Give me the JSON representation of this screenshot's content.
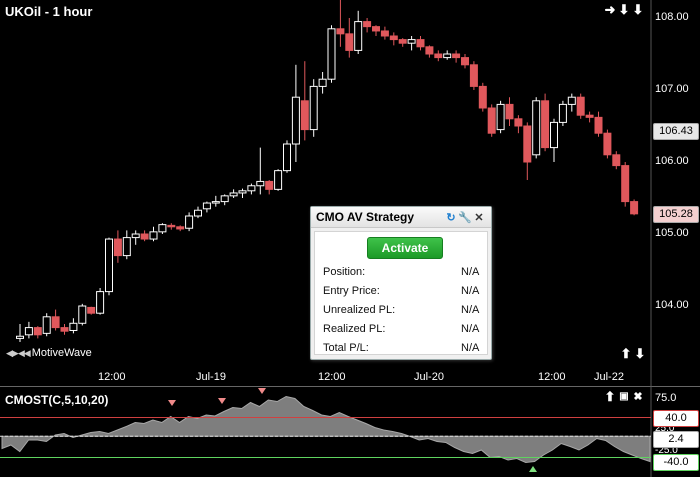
{
  "window": {
    "title": "UKOil - 1 hour",
    "brand": "MotiveWave"
  },
  "price_axis": {
    "labels": [
      "108.00",
      "107.00",
      "106.00",
      "105.00",
      "104.00"
    ],
    "tag_current": "106.43",
    "tag_last": "105.28"
  },
  "time_axis": {
    "labels": [
      "12:00",
      "Jul-19",
      "12:00",
      "Jul-20",
      "12:00",
      "Jul-22"
    ]
  },
  "indicator": {
    "title": "CMOST(C,5,10,20)",
    "axis_labels": [
      "75.0",
      "25.0",
      "-25.0"
    ],
    "tag_upper": "40.0",
    "tag_mid": "2.4",
    "tag_lower": "-40.0"
  },
  "strategy_panel": {
    "title": "CMO AV Strategy",
    "activate_label": "Activate",
    "rows": [
      {
        "label": "Position:",
        "value": "N/A"
      },
      {
        "label": "Entry Price:",
        "value": "N/A"
      },
      {
        "label": "Unrealized PL:",
        "value": "N/A"
      },
      {
        "label": "Realized PL:",
        "value": "N/A"
      },
      {
        "label": "Total P/L:",
        "value": "N/A"
      }
    ]
  },
  "icons": {
    "nav_right": "arrow-right-icon",
    "nav_down": "arrow-down-icon",
    "nav_zoom_down": "arrow-down-icon",
    "panel_refresh": "refresh-icon",
    "panel_settings": "wrench-icon",
    "panel_close": "close-icon"
  },
  "colors": {
    "background": "#000000",
    "up_candle": "#ffffff",
    "down_candle": "#e0585c",
    "upper_line": "#d04040",
    "lower_line": "#5fd35f",
    "osc_fill": "#8c8c8c",
    "activate": "#22a32e"
  },
  "chart_data": [
    {
      "type": "candlestick",
      "title": "UKOil - 1 hour",
      "yticks": [
        108.0,
        107.0,
        106.0,
        105.0,
        104.0
      ],
      "ylim": [
        103.3,
        108.4
      ],
      "series": [
        {
          "values": [
            [
              103.55,
              103.75,
              103.5,
              103.58
            ],
            [
              103.6,
              103.78,
              103.55,
              103.7
            ],
            [
              103.7,
              103.72,
              103.55,
              103.6
            ],
            [
              103.62,
              103.9,
              103.58,
              103.85
            ],
            [
              103.85,
              103.95,
              103.66,
              103.7
            ],
            [
              103.7,
              103.75,
              103.6,
              103.65
            ],
            [
              103.66,
              103.83,
              103.62,
              103.76
            ],
            [
              103.76,
              104.03,
              103.73,
              104.0
            ],
            [
              103.98,
              103.99,
              103.88,
              103.9
            ],
            [
              103.9,
              104.25,
              103.88,
              104.2
            ],
            [
              104.2,
              104.95,
              104.15,
              104.93
            ],
            [
              104.93,
              105.05,
              104.6,
              104.7
            ],
            [
              104.7,
              105.05,
              104.65,
              104.95
            ],
            [
              104.95,
              105.05,
              104.85,
              105.0
            ],
            [
              105.0,
              105.05,
              104.9,
              104.93
            ],
            [
              104.93,
              105.1,
              104.9,
              105.03
            ],
            [
              105.03,
              105.15,
              105.0,
              105.13
            ],
            [
              105.12,
              105.15,
              105.06,
              105.1
            ],
            [
              105.1,
              105.12,
              105.04,
              105.07
            ],
            [
              105.08,
              105.3,
              105.04,
              105.25
            ],
            [
              105.25,
              105.38,
              105.22,
              105.33
            ],
            [
              105.35,
              105.45,
              105.3,
              105.43
            ],
            [
              105.43,
              105.53,
              105.38,
              105.45
            ],
            [
              105.45,
              105.55,
              105.4,
              105.53
            ],
            [
              105.53,
              105.62,
              105.5,
              105.57
            ],
            [
              105.57,
              105.63,
              105.5,
              105.6
            ],
            [
              105.6,
              105.7,
              105.55,
              105.67
            ],
            [
              105.67,
              106.2,
              105.55,
              105.73
            ],
            [
              105.73,
              105.75,
              105.55,
              105.62
            ],
            [
              105.62,
              105.9,
              105.6,
              105.88
            ],
            [
              105.88,
              106.3,
              105.85,
              106.25
            ],
            [
              106.25,
              107.35,
              106.0,
              106.9
            ],
            [
              106.85,
              107.4,
              106.3,
              106.45
            ],
            [
              106.45,
              107.15,
              106.35,
              107.05
            ],
            [
              107.05,
              107.25,
              106.95,
              107.15
            ],
            [
              107.15,
              107.9,
              107.1,
              107.85
            ],
            [
              107.85,
              108.25,
              107.6,
              107.78
            ],
            [
              107.78,
              108.0,
              107.45,
              107.55
            ],
            [
              107.55,
              108.1,
              107.5,
              107.95
            ],
            [
              107.95,
              108.0,
              107.8,
              107.88
            ],
            [
              107.88,
              107.9,
              107.75,
              107.82
            ],
            [
              107.82,
              107.88,
              107.7,
              107.75
            ],
            [
              107.75,
              107.8,
              107.62,
              107.7
            ],
            [
              107.7,
              107.72,
              107.6,
              107.65
            ],
            [
              107.65,
              107.75,
              107.55,
              107.7
            ],
            [
              107.7,
              107.75,
              107.55,
              107.6
            ],
            [
              107.6,
              107.62,
              107.45,
              107.5
            ],
            [
              107.5,
              107.55,
              107.4,
              107.45
            ],
            [
              107.45,
              107.55,
              107.42,
              107.5
            ],
            [
              107.5,
              107.55,
              107.38,
              107.45
            ],
            [
              107.45,
              107.5,
              107.3,
              107.35
            ],
            [
              107.35,
              107.4,
              107.0,
              107.05
            ],
            [
              107.05,
              107.1,
              106.7,
              106.75
            ],
            [
              106.75,
              106.8,
              106.35,
              106.4
            ],
            [
              106.45,
              106.85,
              106.4,
              106.8
            ],
            [
              106.8,
              106.9,
              106.5,
              106.6
            ],
            [
              106.6,
              106.65,
              106.4,
              106.5
            ],
            [
              106.5,
              106.55,
              105.75,
              106.0
            ],
            [
              106.1,
              106.9,
              106.05,
              106.85
            ],
            [
              106.85,
              106.95,
              106.15,
              106.2
            ],
            [
              106.2,
              106.6,
              106.0,
              106.55
            ],
            [
              106.55,
              106.85,
              106.5,
              106.8
            ],
            [
              106.8,
              106.95,
              106.7,
              106.9
            ],
            [
              106.9,
              106.95,
              106.6,
              106.65
            ],
            [
              106.65,
              106.7,
              106.55,
              106.62
            ],
            [
              106.62,
              106.7,
              106.35,
              106.4
            ],
            [
              106.4,
              106.45,
              106.05,
              106.1
            ],
            [
              106.1,
              106.15,
              105.9,
              105.95
            ],
            [
              105.95,
              106.0,
              105.38,
              105.45
            ],
            [
              105.45,
              105.48,
              105.26,
              105.28
            ]
          ]
        }
      ]
    },
    {
      "type": "area",
      "title": "CMOST(C,5,10,20)",
      "yticks": [
        75.0,
        25.0,
        -25.0
      ],
      "ylim": [
        -60,
        90
      ],
      "reference_lines": [
        40.0,
        2.4,
        -40.0
      ],
      "series": [
        {
          "values": [
            -22,
            -15,
            -28,
            -5,
            -5,
            -8,
            5,
            8,
            0,
            5,
            10,
            12,
            8,
            15,
            22,
            30,
            28,
            35,
            30,
            42,
            30,
            42,
            38,
            45,
            43,
            52,
            60,
            58,
            70,
            62,
            75,
            72,
            82,
            78,
            62,
            54,
            45,
            42,
            50,
            42,
            35,
            28,
            20,
            15,
            12,
            8,
            2,
            -5,
            -2,
            -8,
            -10,
            -20,
            -28,
            -32,
            -25,
            -40,
            -38,
            -45,
            -42,
            -50,
            -48,
            -35,
            -25,
            -12,
            -18,
            -25,
            -15,
            -2,
            -6,
            -18,
            -28,
            -35,
            -42,
            -48
          ]
        }
      ]
    }
  ]
}
